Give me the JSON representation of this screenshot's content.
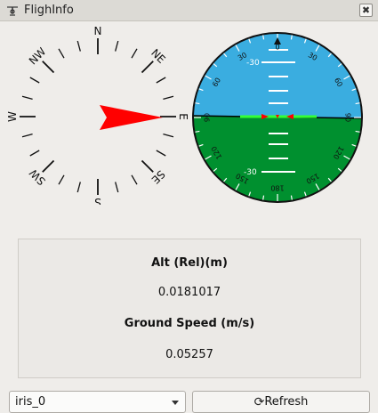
{
  "window": {
    "title": "FlighInfo",
    "close_glyph": "✖"
  },
  "compass": {
    "labels": [
      "N",
      "NE",
      "E",
      "SE",
      "S",
      "SW",
      "W",
      "NW"
    ],
    "heading_deg": 90,
    "needle_color": "#ff0000"
  },
  "attitude": {
    "sky_color": "#3aade0",
    "ground_color": "#00902f",
    "horizon_line_color": "#33ff33",
    "roll_marks": [
      "0",
      "30",
      "30",
      "60",
      "60",
      "90",
      "90",
      "120",
      "120",
      "150",
      "150",
      "180"
    ],
    "pitch_labels": [
      "-30",
      "-30"
    ]
  },
  "info": {
    "alt_label": "Alt (Rel)(m)",
    "alt_value": "0.0181017",
    "speed_label": "Ground Speed (m/s)",
    "speed_value": "0.05257"
  },
  "controls": {
    "vehicle_selected": "iris_0",
    "refresh_label": "Refresh",
    "refresh_icon": "⟳"
  }
}
